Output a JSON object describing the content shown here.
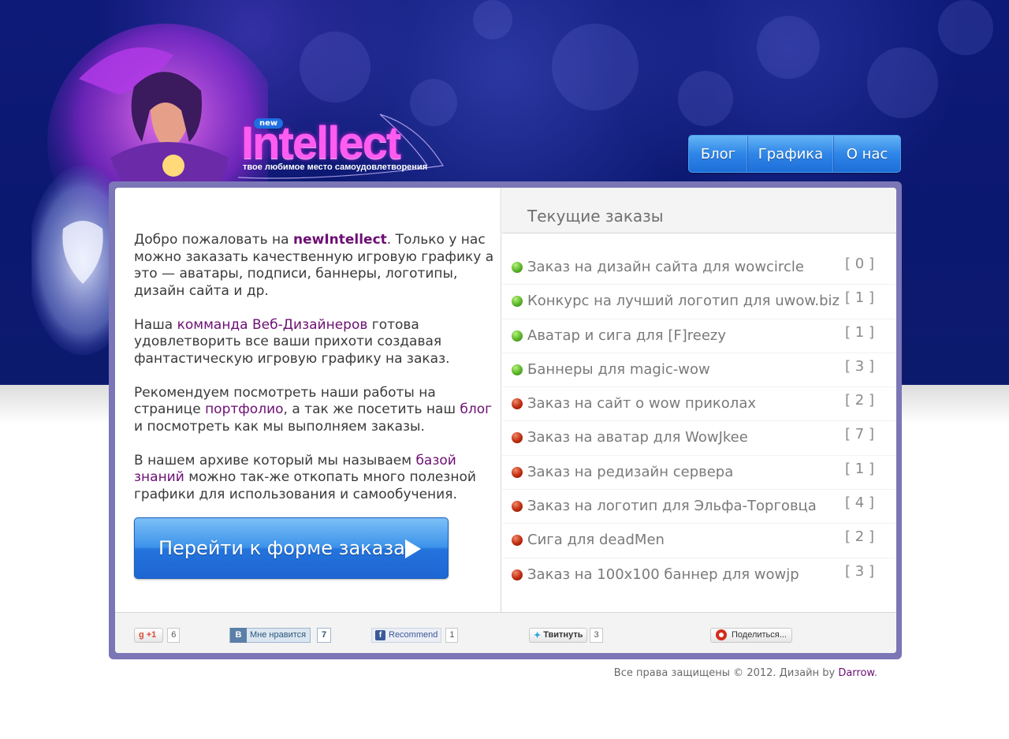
{
  "logo": {
    "badge": "new",
    "word": "Intellect",
    "tagline": "твое любимое место самоудовлетворения"
  },
  "nav": {
    "items": [
      {
        "label": "Блог"
      },
      {
        "label": "Графика"
      },
      {
        "label": "О нас"
      }
    ]
  },
  "intro": {
    "p1_prefix": "Добро пожаловать на ",
    "p1_brand": "newIntellect",
    "p1_suffix": ". Только у нас можно заказать качественную игровую графику а это — аватары, подписи, баннеры, логотипы, дизайн сайта и др.",
    "p2_prefix": "Наша ",
    "p2_link": "комманда Веб-Дизайнеров",
    "p2_suffix": " готова удовлетворить все ваши прихоти создавая фантастическую игровую графику на заказ.",
    "p3_prefix": "Рекомендуем посмотреть наши работы на странице ",
    "p3_link1": "портфолио",
    "p3_middle": ", а так же посетить наш ",
    "p3_link2": "блог",
    "p3_suffix": " и посмотреть как мы выполняем заказы.",
    "p4_prefix": "В нашем архиве который мы называем ",
    "p4_link": "базой знаний",
    "p4_suffix": " можно так-же откопать много полезной графики для использования и самообучения."
  },
  "order_button": {
    "label": "Перейти к форме заказа"
  },
  "orders": {
    "heading": "Текущие заказы",
    "items": [
      {
        "title": "Заказ на дизайн сайта для wowcircle",
        "count": "[ 0 ]",
        "status": "green"
      },
      {
        "title": "Конкурс на лучший логотип для uwow.biz",
        "count": "[ 1 ]",
        "status": "green"
      },
      {
        "title": "Аватар и сига для [F]reezy",
        "count": "[ 1 ]",
        "status": "green"
      },
      {
        "title": "Баннеры для magic-wow",
        "count": "[ 3 ]",
        "status": "green"
      },
      {
        "title": "Заказ на сайт о wow приколах",
        "count": "[ 2 ]",
        "status": "red"
      },
      {
        "title": "Заказ на аватар для WowJkee",
        "count": "[ 7 ]",
        "status": "red"
      },
      {
        "title": "Заказ на редизайн сервера",
        "count": "[ 1 ]",
        "status": "red"
      },
      {
        "title": "Заказ на логотип для Эльфа-Торговца",
        "count": "[ 4 ]",
        "status": "red"
      },
      {
        "title": "Сига для deadMen",
        "count": "[ 2 ]",
        "status": "red"
      },
      {
        "title": "Заказ на 100x100 баннер для wowjp",
        "count": "[ 3 ]",
        "status": "red"
      }
    ]
  },
  "share": {
    "gplus": {
      "label": "+1",
      "count": "6"
    },
    "vk": {
      "logo": "B",
      "label": "Мне нравится",
      "count": "7"
    },
    "fb": {
      "logo": "f",
      "label": "Recommend",
      "count": "1"
    },
    "twitter": {
      "label": "Твитнуть",
      "count": "3"
    },
    "yandex": {
      "label": "Поделиться..."
    }
  },
  "footer": {
    "text": "Все права защищены © 2012. Дизайн by ",
    "link": "Darrow",
    "end": "."
  },
  "colors": {
    "header_bg": "#0e1a78",
    "accent_purple": "#6c0f73",
    "nav_blue": "#2f86e8",
    "frame": "#7b76b6"
  }
}
